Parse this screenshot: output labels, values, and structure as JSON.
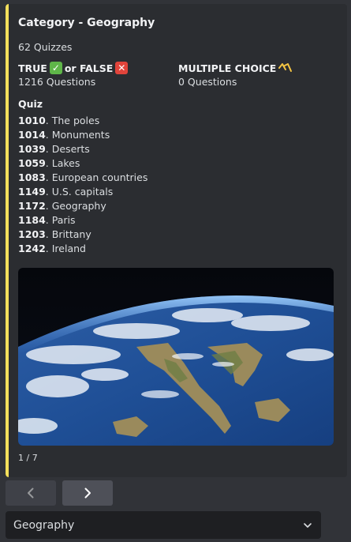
{
  "embed": {
    "accent_color": "#f5e05b",
    "title": "Category - Geography",
    "description": "62 Quizzes",
    "fields": [
      {
        "name_parts": [
          "TRUE",
          "or FALSE"
        ],
        "emoji": [
          "check-mark-icon",
          "cross-mark-icon"
        ],
        "value": "1216 Questions"
      },
      {
        "name": "MULTIPLE CHOICE",
        "emoji": "multiple-choice-icon",
        "value": "0 Questions"
      }
    ],
    "quiz_heading": "Quiz",
    "quizzes": [
      {
        "id": "1010",
        "title": ". The poles"
      },
      {
        "id": "1014",
        "title": ". Monuments"
      },
      {
        "id": "1039",
        "title": ". Deserts"
      },
      {
        "id": "1059",
        "title": ". Lakes"
      },
      {
        "id": "1083",
        "title": ". European countries"
      },
      {
        "id": "1149",
        "title": ". U.S. capitals"
      },
      {
        "id": "1172",
        "title": ". Geography"
      },
      {
        "id": "1184",
        "title": ". Paris"
      },
      {
        "id": "1203",
        "title": ". Brittany"
      },
      {
        "id": "1242",
        "title": ". Ireland"
      }
    ],
    "image": "earth-from-space-photo",
    "footer": "1 / 7"
  },
  "buttons": {
    "prev_icon": "chevron-left-icon",
    "next_icon": "chevron-right-icon"
  },
  "select": {
    "value": "Geography",
    "icon": "chevron-down-icon"
  }
}
